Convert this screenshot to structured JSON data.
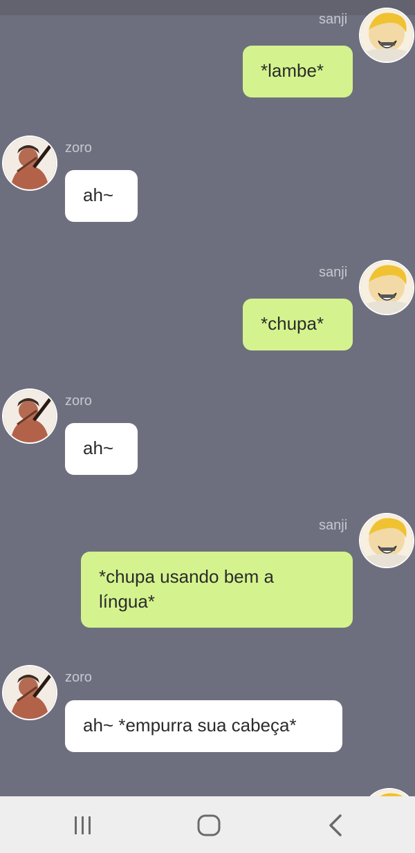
{
  "messages": [
    {
      "from": "sanji",
      "side": "right",
      "name": "sanji",
      "text": "*lambe*",
      "avatar": "sanji-avatar"
    },
    {
      "from": "zoro",
      "side": "left",
      "name": "zoro",
      "text": "ah~",
      "avatar": "zoro-avatar"
    },
    {
      "from": "sanji",
      "side": "right",
      "name": "sanji",
      "text": "*chupa*",
      "avatar": "sanji-avatar"
    },
    {
      "from": "zoro",
      "side": "left",
      "name": "zoro",
      "text": "ah~",
      "avatar": "zoro-avatar"
    },
    {
      "from": "sanji",
      "side": "right",
      "name": "sanji",
      "text": "*chupa usando bem a língua*",
      "avatar": "sanji-avatar"
    },
    {
      "from": "zoro",
      "side": "left",
      "name": "zoro",
      "text": "ah~ *empurra sua cabeça*",
      "avatar": "zoro-avatar"
    }
  ],
  "navbar": {
    "recents": "recent-apps-icon",
    "home": "home-icon",
    "back": "back-icon"
  },
  "colors": {
    "background": "#6e6f7e",
    "sent_bubble": "#d4f38e",
    "received_bubble": "#ffffff",
    "name_text": "#c7c8d1",
    "navbar": "#eeeeee"
  }
}
